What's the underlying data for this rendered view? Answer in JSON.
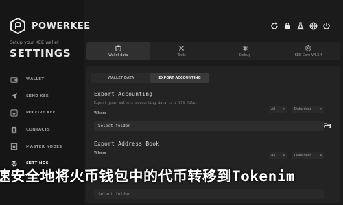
{
  "app": {
    "name": "POWERKEE",
    "tagline": "Setup your KEE wallet",
    "page_title": "SETTINGS"
  },
  "sidebar": {
    "items": [
      {
        "label": "WALLET",
        "icon": "wallet-icon"
      },
      {
        "label": "SEND KEE",
        "icon": "send-icon"
      },
      {
        "label": "RECEIVE KEE",
        "icon": "receive-icon"
      },
      {
        "label": "CONTACTS",
        "icon": "contacts-icon"
      },
      {
        "label": "MASTER NODES",
        "icon": "master-nodes-icon"
      },
      {
        "label": "SETTINGS",
        "icon": "gear-icon"
      }
    ],
    "active": "SETTINGS"
  },
  "header": {
    "icons": [
      "refresh-icon",
      "lock-icon",
      "flask-icon",
      "globe-icon",
      "power-icon"
    ]
  },
  "top_tabs": [
    {
      "label": "Wallet data",
      "icon": "database-icon"
    },
    {
      "label": "Tools",
      "icon": "tools-icon"
    },
    {
      "label": "Debug",
      "icon": "debug-icon"
    },
    {
      "label": "KEE Core V4.3.4",
      "icon": "core-icon"
    }
  ],
  "sub_tabs": {
    "wallet_data": "WALLET DATA",
    "export_accounting": "EXPORT ACCOUNTING"
  },
  "export_accounting": {
    "title": "Export Accounting",
    "description": "Export your wallets accounting data to a CSV file.",
    "where_label": "Where",
    "filter_value": "All",
    "sort_value": "Date desc",
    "folder_placeholder": "Select folder"
  },
  "export_address_book": {
    "title": "Export Address Book",
    "where_label": "Where",
    "filter_value": "All",
    "sort_value": "Date desc",
    "folder_placeholder": "Select folder"
  },
  "overlay_caption": "速安全地将火币钱包中的代币转移到Tokenim",
  "colors": {
    "background": "#1b1b1c",
    "sidebar": "#161617",
    "panel": "#232324",
    "active_tab": "#3a3a3b",
    "text_primary": "#e6e6e6",
    "text_muted": "#9b9b9b"
  }
}
